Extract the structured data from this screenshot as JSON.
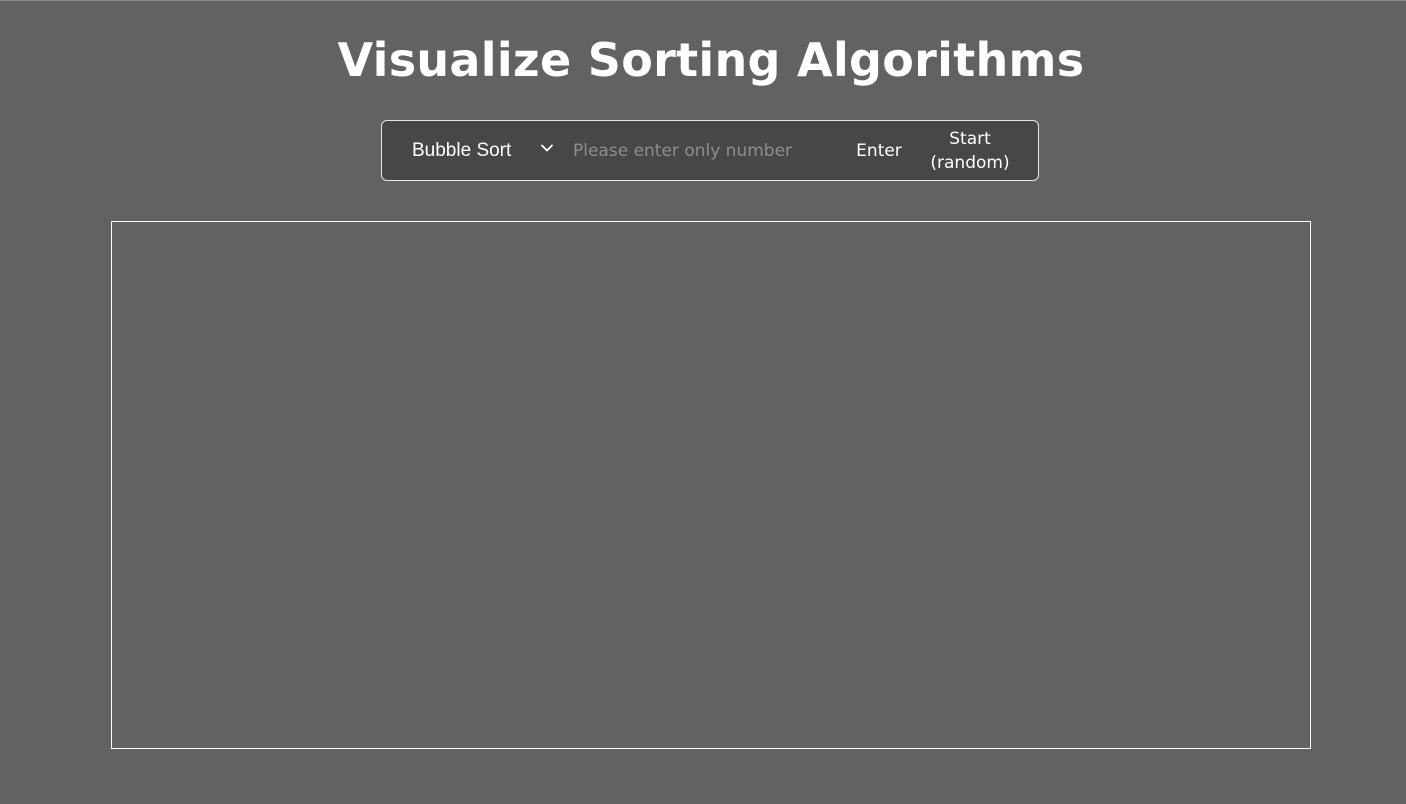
{
  "header": {
    "title": "Visualize Sorting Algorithms"
  },
  "controls": {
    "algorithm": {
      "selected": "Bubble Sort",
      "icon": "chevron-down-icon"
    },
    "number_input": {
      "value": "",
      "placeholder": "Please enter only number"
    },
    "enter_label": "Enter",
    "start_label_line1": "Start",
    "start_label_line2": "(random)"
  },
  "visualizer": {
    "bars": []
  },
  "colors": {
    "background": "#626262",
    "panel": "#474747",
    "text": "#ffffff",
    "placeholder": "#8e8e8e",
    "border": "#ffffff"
  }
}
